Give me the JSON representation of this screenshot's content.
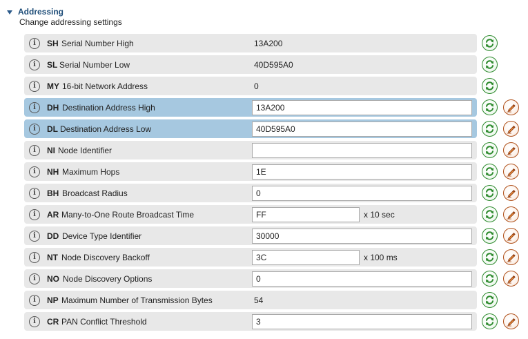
{
  "section": {
    "title": "Addressing",
    "description": "Change addressing settings"
  },
  "colors": {
    "row_background": "#e8e8e8",
    "row_selected": "#a6c8e0",
    "refresh_green": "#2e8b2e",
    "write_orange": "#b0521c",
    "header_blue": "#1f4e79"
  },
  "icons": {
    "info": "info-icon",
    "refresh": "refresh-icon",
    "write": "write-pencil-icon",
    "section_toggle": "collapse-triangle-icon"
  },
  "rows": [
    {
      "param": "SH",
      "name": "Serial Number High",
      "value": "13A200",
      "editable": false,
      "selected": false,
      "unit": ""
    },
    {
      "param": "SL",
      "name": "Serial Number Low",
      "value": "40D595A0",
      "editable": false,
      "selected": false,
      "unit": ""
    },
    {
      "param": "MY",
      "name": "16-bit Network Address",
      "value": "0",
      "editable": false,
      "selected": false,
      "unit": ""
    },
    {
      "param": "DH",
      "name": "Destination Address High",
      "value": "13A200",
      "editable": true,
      "selected": true,
      "unit": ""
    },
    {
      "param": "DL",
      "name": "Destination Address Low",
      "value": "40D595A0",
      "editable": true,
      "selected": true,
      "unit": ""
    },
    {
      "param": "NI",
      "name": "Node Identifier",
      "value": "",
      "editable": true,
      "selected": false,
      "unit": ""
    },
    {
      "param": "NH",
      "name": "Maximum Hops",
      "value": "1E",
      "editable": true,
      "selected": false,
      "unit": ""
    },
    {
      "param": "BH",
      "name": "Broadcast Radius",
      "value": "0",
      "editable": true,
      "selected": false,
      "unit": ""
    },
    {
      "param": "AR",
      "name": "Many-to-One Route Broadcast Time",
      "value": "FF",
      "editable": true,
      "selected": false,
      "unit": "x 10 sec"
    },
    {
      "param": "DD",
      "name": "Device Type Identifier",
      "value": "30000",
      "editable": true,
      "selected": false,
      "unit": ""
    },
    {
      "param": "NT",
      "name": "Node Discovery Backoff",
      "value": "3C",
      "editable": true,
      "selected": false,
      "unit": "x 100 ms"
    },
    {
      "param": "NO",
      "name": "Node Discovery Options",
      "value": "0",
      "editable": true,
      "selected": false,
      "unit": ""
    },
    {
      "param": "NP",
      "name": "Maximum Number of Transmission Bytes",
      "value": "54",
      "editable": false,
      "selected": false,
      "unit": ""
    },
    {
      "param": "CR",
      "name": "PAN Conflict Threshold",
      "value": "3",
      "editable": true,
      "selected": false,
      "unit": ""
    }
  ]
}
